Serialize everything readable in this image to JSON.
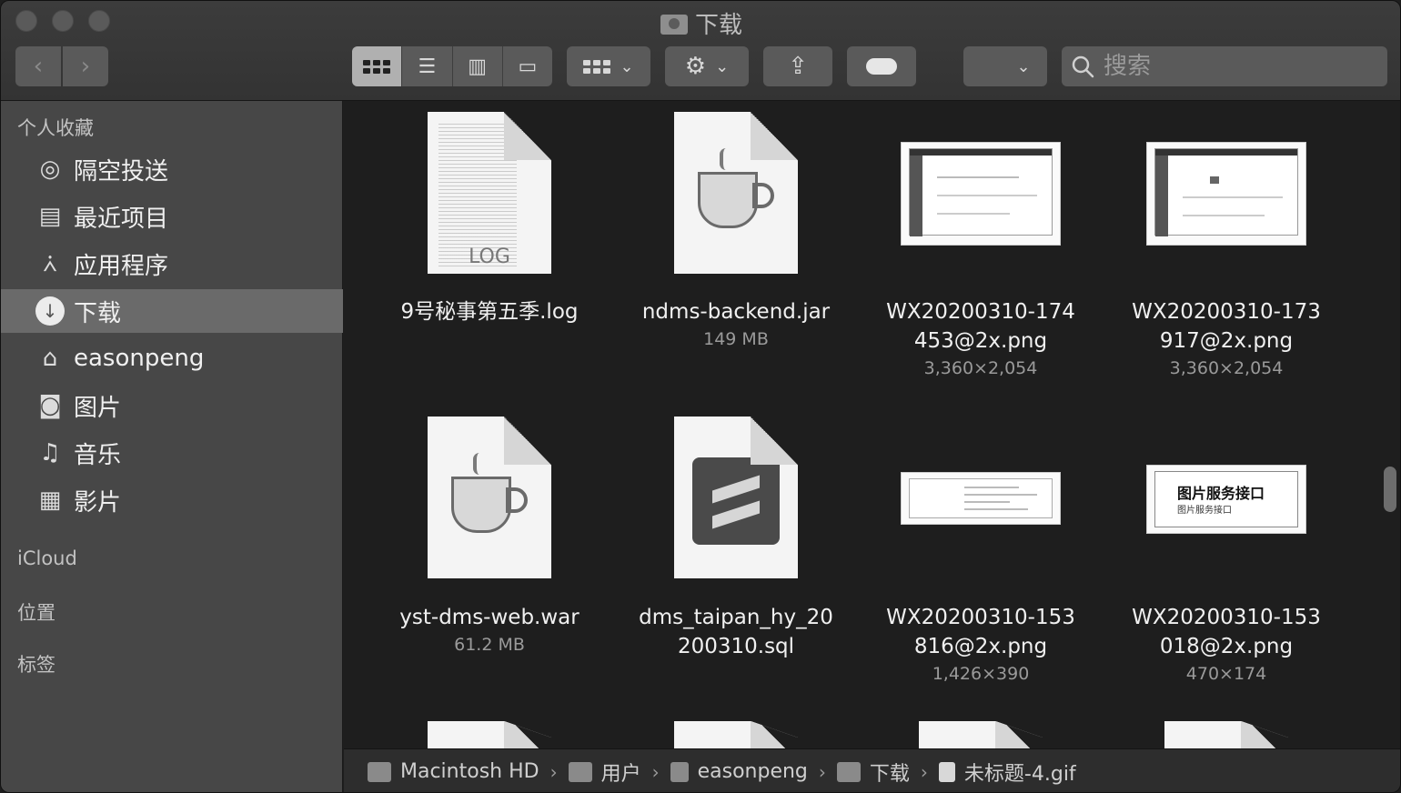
{
  "window": {
    "title": "下载"
  },
  "toolbar": {
    "back_icon": "chevron-left",
    "forward_icon": "chevron-right",
    "view_modes": [
      "icon-view",
      "list-view",
      "column-view",
      "gallery-view"
    ],
    "group_icon": "grid-group-icon",
    "action_icon": "gear-icon",
    "share_icon": "share-icon",
    "tag_icon": "tag-icon",
    "search_placeholder": "搜索"
  },
  "sidebar": {
    "favorites_header": "个人收藏",
    "items": [
      {
        "label": "隔空投送",
        "icon": "airdrop-icon"
      },
      {
        "label": "最近项目",
        "icon": "recents-icon"
      },
      {
        "label": "应用程序",
        "icon": "applications-icon"
      },
      {
        "label": "下载",
        "icon": "download-icon",
        "selected": true
      },
      {
        "label": "easonpeng",
        "icon": "home-icon"
      },
      {
        "label": "图片",
        "icon": "camera-icon"
      },
      {
        "label": "音乐",
        "icon": "music-icon"
      },
      {
        "label": "影片",
        "icon": "film-icon"
      }
    ],
    "icloud_header": "iCloud",
    "locations_header": "位置",
    "tags_header": "标签"
  },
  "files": [
    {
      "name": "9号秘事第五季.log",
      "meta": "",
      "kind": "log"
    },
    {
      "name": "ndms-backend.jar",
      "meta": "149 MB",
      "kind": "java"
    },
    {
      "name": "WX20200310-174\n453@2x.png",
      "meta": "3,360×2,054",
      "kind": "screenshot"
    },
    {
      "name": "WX20200310-173\n917@2x.png",
      "meta": "3,360×2,054",
      "kind": "screenshot"
    },
    {
      "name": "yst-dms-web.war",
      "meta": "61.2 MB",
      "kind": "java"
    },
    {
      "name": "dms_taipan_hy_20\n200310.sql",
      "meta": "",
      "kind": "sublime"
    },
    {
      "name": "WX20200310-153\n816@2x.png",
      "meta": "1,426×390",
      "kind": "code-screenshot"
    },
    {
      "name": "WX20200310-153\n018@2x.png",
      "meta": "470×174",
      "kind": "card-screenshot",
      "card_title": "图片服务接口",
      "card_sub": "图片服务接口"
    }
  ],
  "pathbar": [
    {
      "label": "Macintosh HD",
      "icon": "disk-icon"
    },
    {
      "label": "用户",
      "icon": "folder-icon"
    },
    {
      "label": "easonpeng",
      "icon": "home-icon"
    },
    {
      "label": "下载",
      "icon": "downloads-folder-icon"
    },
    {
      "label": "未标题-4.gif",
      "icon": "file-icon"
    }
  ],
  "log_label": "LOG"
}
